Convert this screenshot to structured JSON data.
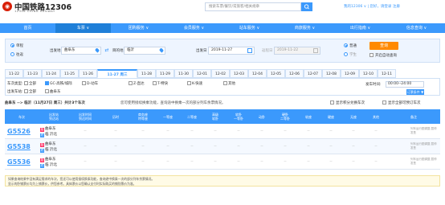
{
  "header": {
    "logo_mark": "◉",
    "title": "中国铁路12306",
    "subtitle": "12306 CHINA RAILWAY",
    "search_placeholder": "搜索车票/餐饮/常旅客/相关规章",
    "right_links": "我的12306 ∨  |  您好，请登录 注册"
  },
  "nav": [
    "首页",
    "车票 ∨",
    "团购服务 ∨",
    "会员服务 ∨",
    "站车服务 ∨",
    "商旅服务 ∨",
    "出行指南 ∨",
    "信息查询 ∨"
  ],
  "search": {
    "trip_oneway": "单程",
    "trip_return": "往返",
    "from_label": "出发地",
    "from_value": "曲阜东",
    "to_label": "目的地",
    "to_value": "临沂",
    "depart_label": "出发日",
    "depart_value": "2019-11-27",
    "return_label": "返程日",
    "return_value": "2019-11-22",
    "type_normal": "普通",
    "type_student": "学生",
    "query_button": "查询",
    "auto_query": "开启自动查询"
  },
  "date_tabs": [
    "11-22",
    "11-23",
    "11-24",
    "11-25",
    "11-26",
    "11-27 周三",
    "11-28",
    "11-29",
    "11-30",
    "12-01",
    "12-02",
    "12-03",
    "12-04",
    "12-05",
    "12-06",
    "12-07",
    "12-08",
    "12-09",
    "12-10",
    "12-11"
  ],
  "filters": {
    "type_label": "车次类型:",
    "all": "全部",
    "types": [
      "GC-高铁/城际",
      "D-动车",
      "Z-直达",
      "T-特快",
      "K-快速",
      "其他"
    ],
    "station_label": "出发车站:",
    "stations": [
      "全部",
      "曲阜东"
    ],
    "time_label": "发车时间:",
    "time_value": "00:00--24:00",
    "filter_button": "订票条件 ▼"
  },
  "info": {
    "route": "曲阜东 --> 临沂（11月27日 周三）共计3个车次",
    "tip": "您可使用接续换乘功能，查询途中换乘一次的部分列车余票情况。",
    "show_price": "显示积分兑换车次",
    "show_all": "显示全部可预订车次"
  },
  "table": {
    "headers": [
      "车次",
      "出发站\n到达站",
      "出发时间\n到达时间",
      "历时",
      "商务座\n特等座",
      "一等座",
      "二等座",
      "高级\n软卧",
      "软卧\n一等卧",
      "动卧",
      "硬卧\n二等卧",
      "软座",
      "硬座",
      "无座",
      "其他",
      "备注"
    ],
    "rows": [
      {
        "train": "G5526",
        "from": "曲阜东",
        "to": "临 沂北",
        "cells": [
          "--",
          "--",
          "--",
          "--",
          "--",
          "--",
          "--",
          "--",
          "--",
          "--",
          "--",
          "--",
          "--",
          "--",
          "--"
        ],
        "note": "列车运行图调整,暂停发售"
      },
      {
        "train": "G5538",
        "from": "曲阜东",
        "to": "临 沂北",
        "cells": [
          "--",
          "--",
          "--",
          "--",
          "--",
          "--",
          "--",
          "--",
          "--",
          "--",
          "--",
          "--",
          "--",
          "--",
          "--"
        ],
        "note": "列车运行图调整,暂停发售"
      },
      {
        "train": "G5536",
        "from": "曲阜东",
        "to": "临 沂北",
        "cells": [
          "--",
          "--",
          "--",
          "--",
          "--",
          "--",
          "--",
          "--",
          "--",
          "--",
          "--",
          "--",
          "--",
          "--",
          "--"
        ],
        "note": "列车运行图调整,暂停发售"
      }
    ]
  },
  "notice": {
    "line1": "如果查询结果中没有满足需求的车次，您还可以使用接续换乘功能，查询途中换乘一次的部分列车余票情况。",
    "line2": "显示的卧铺票价均为上铺票价，供您参考。具体票价以您确认支付时实际购买的铺别票价为准。"
  },
  "colors": {
    "primary": "#3b99fc",
    "logo": "#d81e06",
    "query": "#ff8a00"
  }
}
